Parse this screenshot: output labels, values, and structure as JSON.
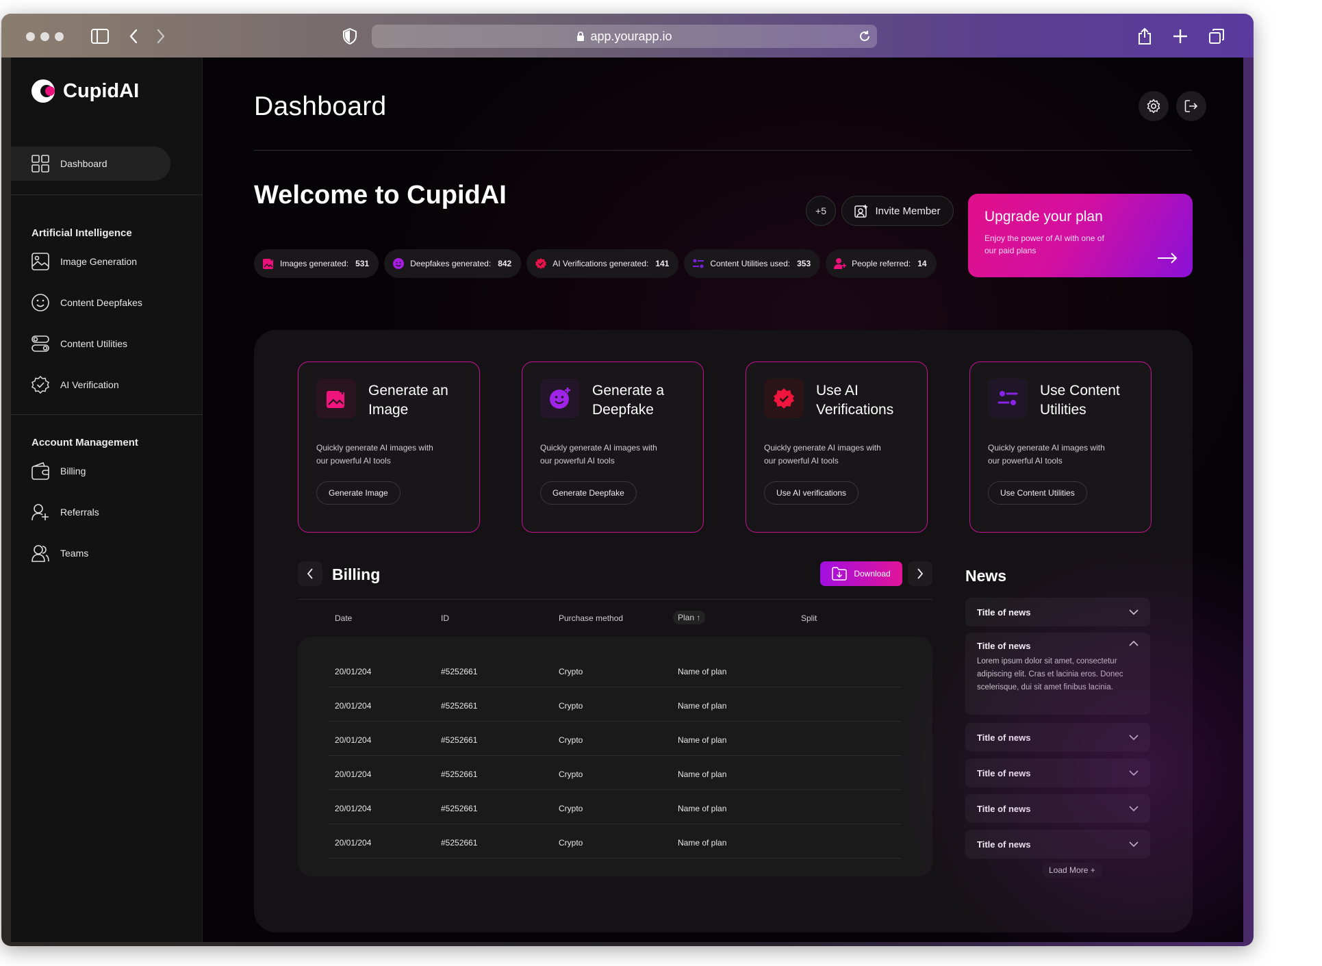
{
  "browser": {
    "url": "app.yourapp.io"
  },
  "sidebar": {
    "brand": "CupidAI",
    "items": [
      {
        "label": "Dashboard",
        "icon": "grid-icon"
      }
    ],
    "sections": [
      {
        "title": "Artificial Intelligence",
        "items": [
          {
            "label": "Image Generation",
            "icon": "image-icon"
          },
          {
            "label": "Content Deepfakes",
            "icon": "smiley-icon"
          },
          {
            "label": "Content Utilities",
            "icon": "toggles-icon"
          },
          {
            "label": "AI Verification",
            "icon": "badge-check-icon"
          }
        ]
      },
      {
        "title": "Account Management",
        "items": [
          {
            "label": "Billing",
            "icon": "wallet-icon"
          },
          {
            "label": "Referrals",
            "icon": "user-plus-icon"
          },
          {
            "label": "Teams",
            "icon": "users-icon"
          }
        ]
      }
    ]
  },
  "header": {
    "title": "Dashboard"
  },
  "welcome": {
    "title": "Welcome to CupidAI",
    "members_more": "+5",
    "invite_label": "Invite Member"
  },
  "stats": [
    {
      "label": "Images generated:",
      "value": "531",
      "color": "#e8127a"
    },
    {
      "label": "Deepfakes generated:",
      "value": "842",
      "color": "#a51ee0"
    },
    {
      "label": "AI Verifications generated:",
      "value": "141",
      "color": "#e8124a"
    },
    {
      "label": "Content Utilities used:",
      "value": "353",
      "color": "#7a1ee0"
    },
    {
      "label": "People referred:",
      "value": "14",
      "color": "#e8127a"
    }
  ],
  "upgrade": {
    "title": "Upgrade your plan",
    "subtitle": "Enjoy the power of AI with one of our paid plans"
  },
  "cards": [
    {
      "title": "Generate an Image",
      "desc": "Quickly generate AI images with our powerful AI tools",
      "button": "Generate Image",
      "icon": "image-add-icon",
      "color": "#f0157c",
      "bg": "#2a1420"
    },
    {
      "title": "Generate a Deepfake",
      "desc": "Quickly generate AI images with our powerful AI tools",
      "button": "Generate Deepfake",
      "icon": "smiley-icon",
      "color": "#a023e8",
      "bg": "#231628"
    },
    {
      "title": "Use AI Verifications",
      "desc": "Quickly generate AI images with our powerful AI tools",
      "button": "Use AI verifications",
      "icon": "badge-check-icon",
      "color": "#f0153c",
      "bg": "#2a1418"
    },
    {
      "title": "Use Content Utilities",
      "desc": "Quickly generate AI images with our powerful AI tools",
      "button": "Use Content Utilities",
      "icon": "toggles-icon",
      "color": "#8a23e8",
      "bg": "#1f1628"
    }
  ],
  "billing": {
    "title": "Billing",
    "download_label": "Download",
    "columns": [
      "Date",
      "ID",
      "Purchase method",
      "Plan",
      "Split"
    ],
    "sort_indicator": "↑",
    "rows": [
      {
        "date": "20/01/204",
        "id": "#5252661",
        "method": "Crypto",
        "plan": "Name of plan"
      },
      {
        "date": "20/01/204",
        "id": "#5252661",
        "method": "Crypto",
        "plan": "Name of plan"
      },
      {
        "date": "20/01/204",
        "id": "#5252661",
        "method": "Crypto",
        "plan": "Name of plan"
      },
      {
        "date": "20/01/204",
        "id": "#5252661",
        "method": "Crypto",
        "plan": "Name of plan"
      },
      {
        "date": "20/01/204",
        "id": "#5252661",
        "method": "Crypto",
        "plan": "Name of plan"
      },
      {
        "date": "20/01/204",
        "id": "#5252661",
        "method": "Crypto",
        "plan": "Name of plan"
      }
    ]
  },
  "news": {
    "title": "News",
    "items": [
      {
        "title": "Title of news",
        "expanded": false
      },
      {
        "title": "Title of news",
        "expanded": true,
        "body": "Lorem ipsum dolor sit amet, consectetur adipiscing elit. Cras et lacinia eros. Donec scelerisque, dui sit amet finibus lacinia."
      },
      {
        "title": "Title of news",
        "expanded": false
      },
      {
        "title": "Title of news",
        "expanded": false
      },
      {
        "title": "Title of news",
        "expanded": false
      },
      {
        "title": "Title of news",
        "expanded": false
      }
    ],
    "load_more": "Load More +"
  }
}
